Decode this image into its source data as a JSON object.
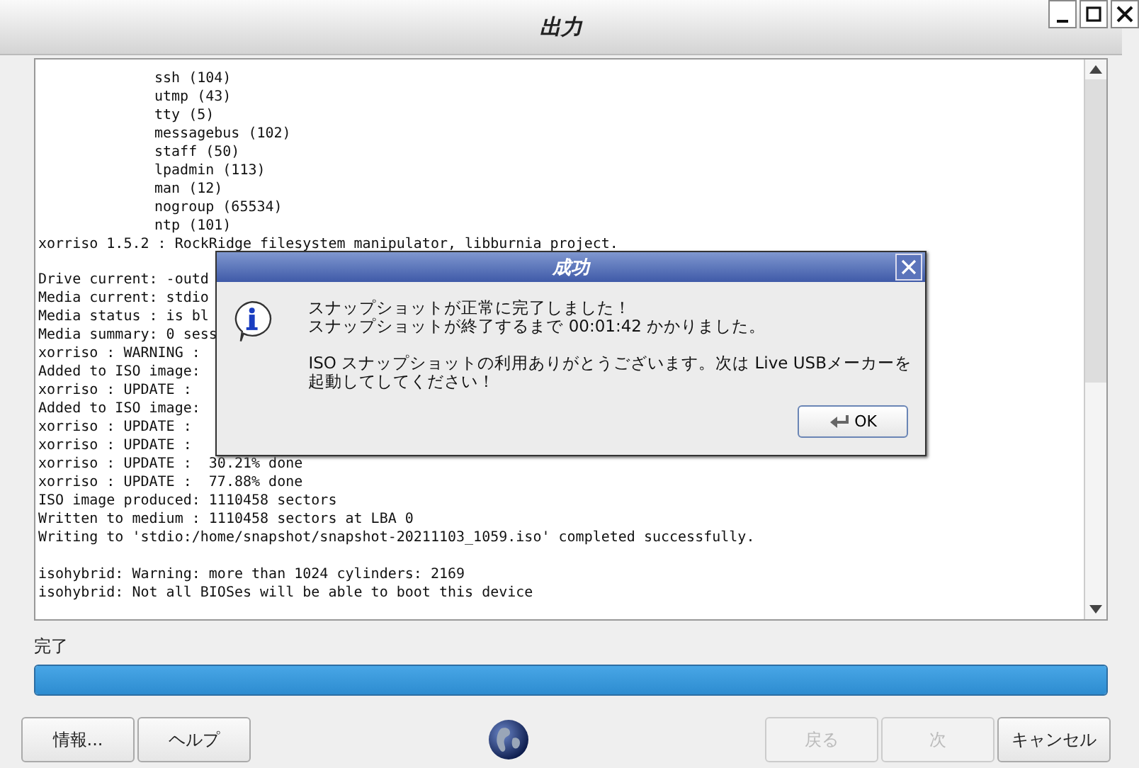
{
  "window": {
    "title": "出力"
  },
  "log": {
    "lines": [
      {
        "kind": "entry",
        "text": "ssh (104)"
      },
      {
        "kind": "entry",
        "text": "utmp (43)"
      },
      {
        "kind": "entry",
        "text": "tty (5)"
      },
      {
        "kind": "entry",
        "text": "messagebus (102)"
      },
      {
        "kind": "entry",
        "text": "staff (50)"
      },
      {
        "kind": "entry",
        "text": "lpadmin (113)"
      },
      {
        "kind": "entry",
        "text": "man (12)"
      },
      {
        "kind": "entry",
        "text": "nogroup (65534)"
      },
      {
        "kind": "entry",
        "text": "ntp (101)"
      },
      {
        "kind": "line",
        "text": "xorriso 1.5.2 : RockRidge filesystem manipulator, libburnia project."
      },
      {
        "kind": "gap"
      },
      {
        "kind": "line",
        "text": "Drive current: -outd"
      },
      {
        "kind": "line",
        "text": "Media current: stdio"
      },
      {
        "kind": "line",
        "text": "Media status : is bl"
      },
      {
        "kind": "line",
        "text": "Media summary: 0 sess"
      },
      {
        "kind": "line",
        "text": "xorriso : WARNING :"
      },
      {
        "kind": "line",
        "text": "Added to ISO image:"
      },
      {
        "kind": "line",
        "text": "xorriso : UPDATE :"
      },
      {
        "kind": "line",
        "text": "Added to ISO image:"
      },
      {
        "kind": "line",
        "text": "xorriso : UPDATE :"
      },
      {
        "kind": "line",
        "text": "xorriso : UPDATE :"
      },
      {
        "kind": "line",
        "text": "xorriso : UPDATE :  30.21% done"
      },
      {
        "kind": "line",
        "text": "xorriso : UPDATE :  77.88% done"
      },
      {
        "kind": "line",
        "text": "ISO image produced: 1110458 sectors"
      },
      {
        "kind": "line",
        "text": "Written to medium : 1110458 sectors at LBA 0"
      },
      {
        "kind": "line",
        "text": "Writing to 'stdio:/home/snapshot/snapshot-20211103_1059.iso' completed successfully."
      },
      {
        "kind": "gap"
      },
      {
        "kind": "line",
        "text": "isohybrid: Warning: more than 1024 cylinders: 2169"
      },
      {
        "kind": "line",
        "text": "isohybrid: Not all BIOSes will be able to boot this device"
      }
    ]
  },
  "dialog": {
    "title": "成功",
    "lines": [
      "スナップショットが正常に完了しました！",
      "スナップショットが終了するまで 00:01:42 かかりました。"
    ],
    "paragraph": "ISO スナップショットの利用ありがとうございます。次は Live USBメーカーを起動してしてください！",
    "ok": "OK"
  },
  "status": {
    "label": "完了",
    "level": 1
  },
  "left_buttons": [
    {
      "label": "情報...",
      "disabled": false
    },
    {
      "label": "ヘルプ",
      "disabled": false
    }
  ],
  "right_buttons": [
    {
      "label": "戻る",
      "disabled": true
    },
    {
      "label": "次",
      "disabled": true
    },
    {
      "label": "キャンセル",
      "disabled": false
    }
  ]
}
